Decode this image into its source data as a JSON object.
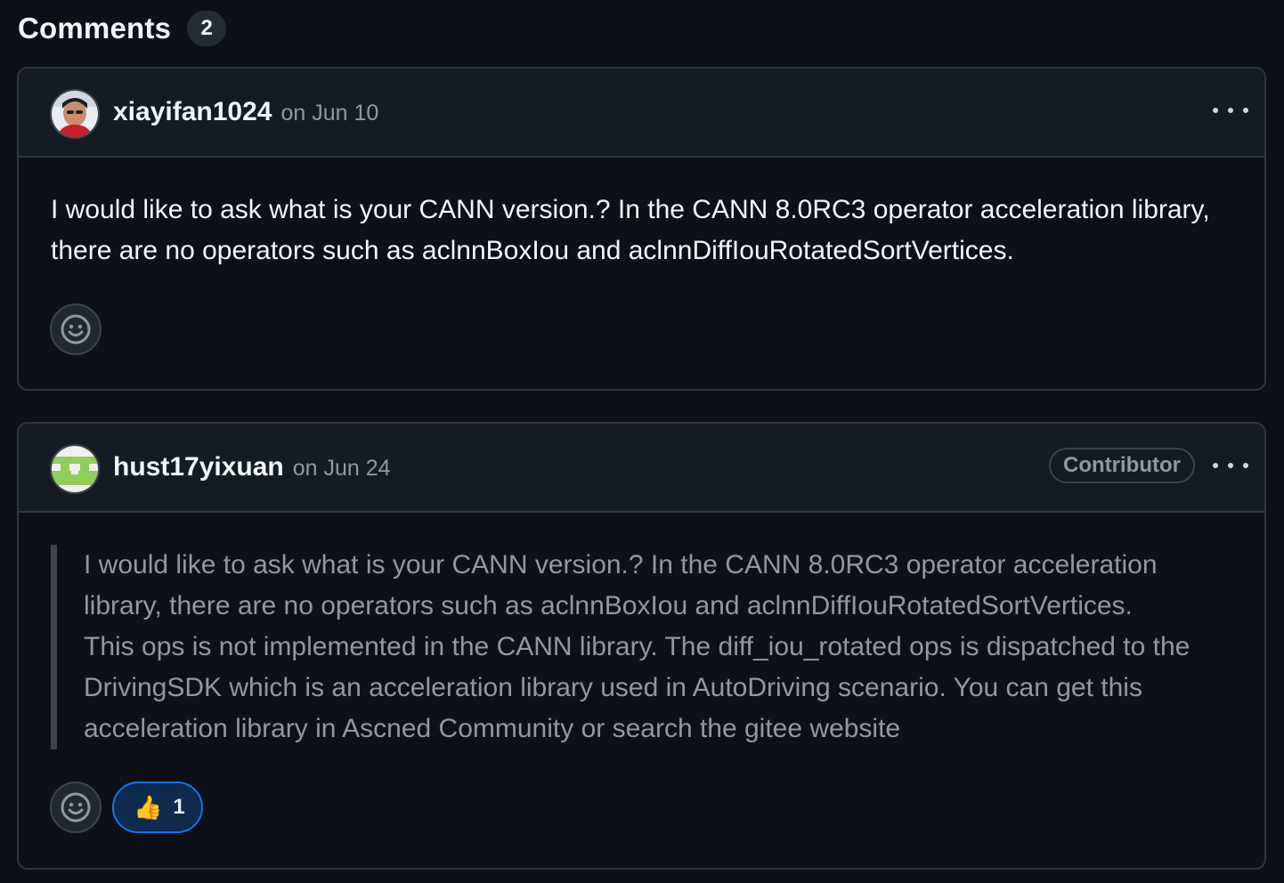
{
  "header": {
    "title": "Comments",
    "count": "2"
  },
  "comments": [
    {
      "author": "xiayifan1024",
      "date": "on Jun 10",
      "body": "I would like to ask what is your CANN version.?  In the CANN 8.0RC3 operator acceleration library, there are no operators such as aclnnBoxIou and aclnnDiffIouRotatedSortVertices.",
      "avatar_icon": "user-photo-avatar",
      "menu_icon": "kebab-icon",
      "emoji_icon": "smiley-icon"
    },
    {
      "author": "hust17yixuan",
      "date": "on Jun 24",
      "role": "Contributor",
      "quote_quoted": "I would like to ask what is your CANN version.?  In the CANN 8.0RC3 operator acceleration library, there are no operators such as aclnnBoxIou and aclnnDiffIouRotatedSortVertices.",
      "quote_reply": "This ops is not implemented in the CANN library. The diff_iou_rotated ops is dispatched to the DrivingSDK which is an acceleration library used in AutoDriving scenario. You can get this acceleration library in Ascned Community or search the gitee website",
      "avatar_icon": "identicon-avatar",
      "menu_icon": "kebab-icon",
      "emoji_icon": "smiley-icon",
      "reaction": {
        "emoji": "👍",
        "count": "1"
      }
    }
  ],
  "colors": {
    "background": "#0d1117",
    "header_bg": "#151b23",
    "border": "#30363d",
    "muted_text": "#9198a1",
    "reaction_border": "#1f6feb",
    "identicon_green": "#8fce5a"
  }
}
